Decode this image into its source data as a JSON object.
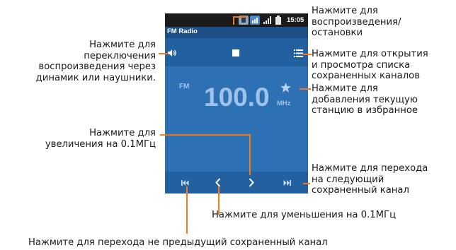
{
  "app": {
    "title": "FM Radio",
    "status_time": "15:05",
    "frequency": "100.0",
    "band_label": "FM",
    "unit_label": "MHz"
  },
  "annotations": {
    "speaker_toggle": [
      "Нажмите для",
      "переключения",
      "воспроизведения через",
      "динамик или наушники."
    ],
    "play_stop": [
      "Нажмите для",
      "воспроизведения/",
      "остановки"
    ],
    "channel_list": [
      "Нажмите для открытия",
      "и просмотра списка",
      "сохраненных каналов"
    ],
    "favorite": [
      "Нажмите для",
      "добавления текущую",
      "станцию в избранное"
    ],
    "step_up": [
      "Нажмите для",
      "увеличения на 0.1МГц"
    ],
    "next_channel": [
      "Нажмите для перехода",
      "на следующий",
      "сохраненный канал"
    ],
    "step_down": "Нажмите для уменьшения на 0.1МГц",
    "prev_channel": "Нажмите для перехода не предыдущий сохраненный канал"
  },
  "icons": {
    "speaker": "speaker-icon",
    "stop": "stop-icon",
    "list": "list-icon",
    "star": "star-icon",
    "prev": "skip-previous-icon",
    "step_down": "chevron-left-icon",
    "step_up": "chevron-right-icon",
    "next": "skip-next-icon"
  },
  "colors": {
    "screen_bg": "#2e70b4",
    "bar_bg": "#23609f",
    "title_bg": "#1d4f86",
    "freq_text": "#9fc3e8",
    "leader_line": "#f07b1c"
  }
}
